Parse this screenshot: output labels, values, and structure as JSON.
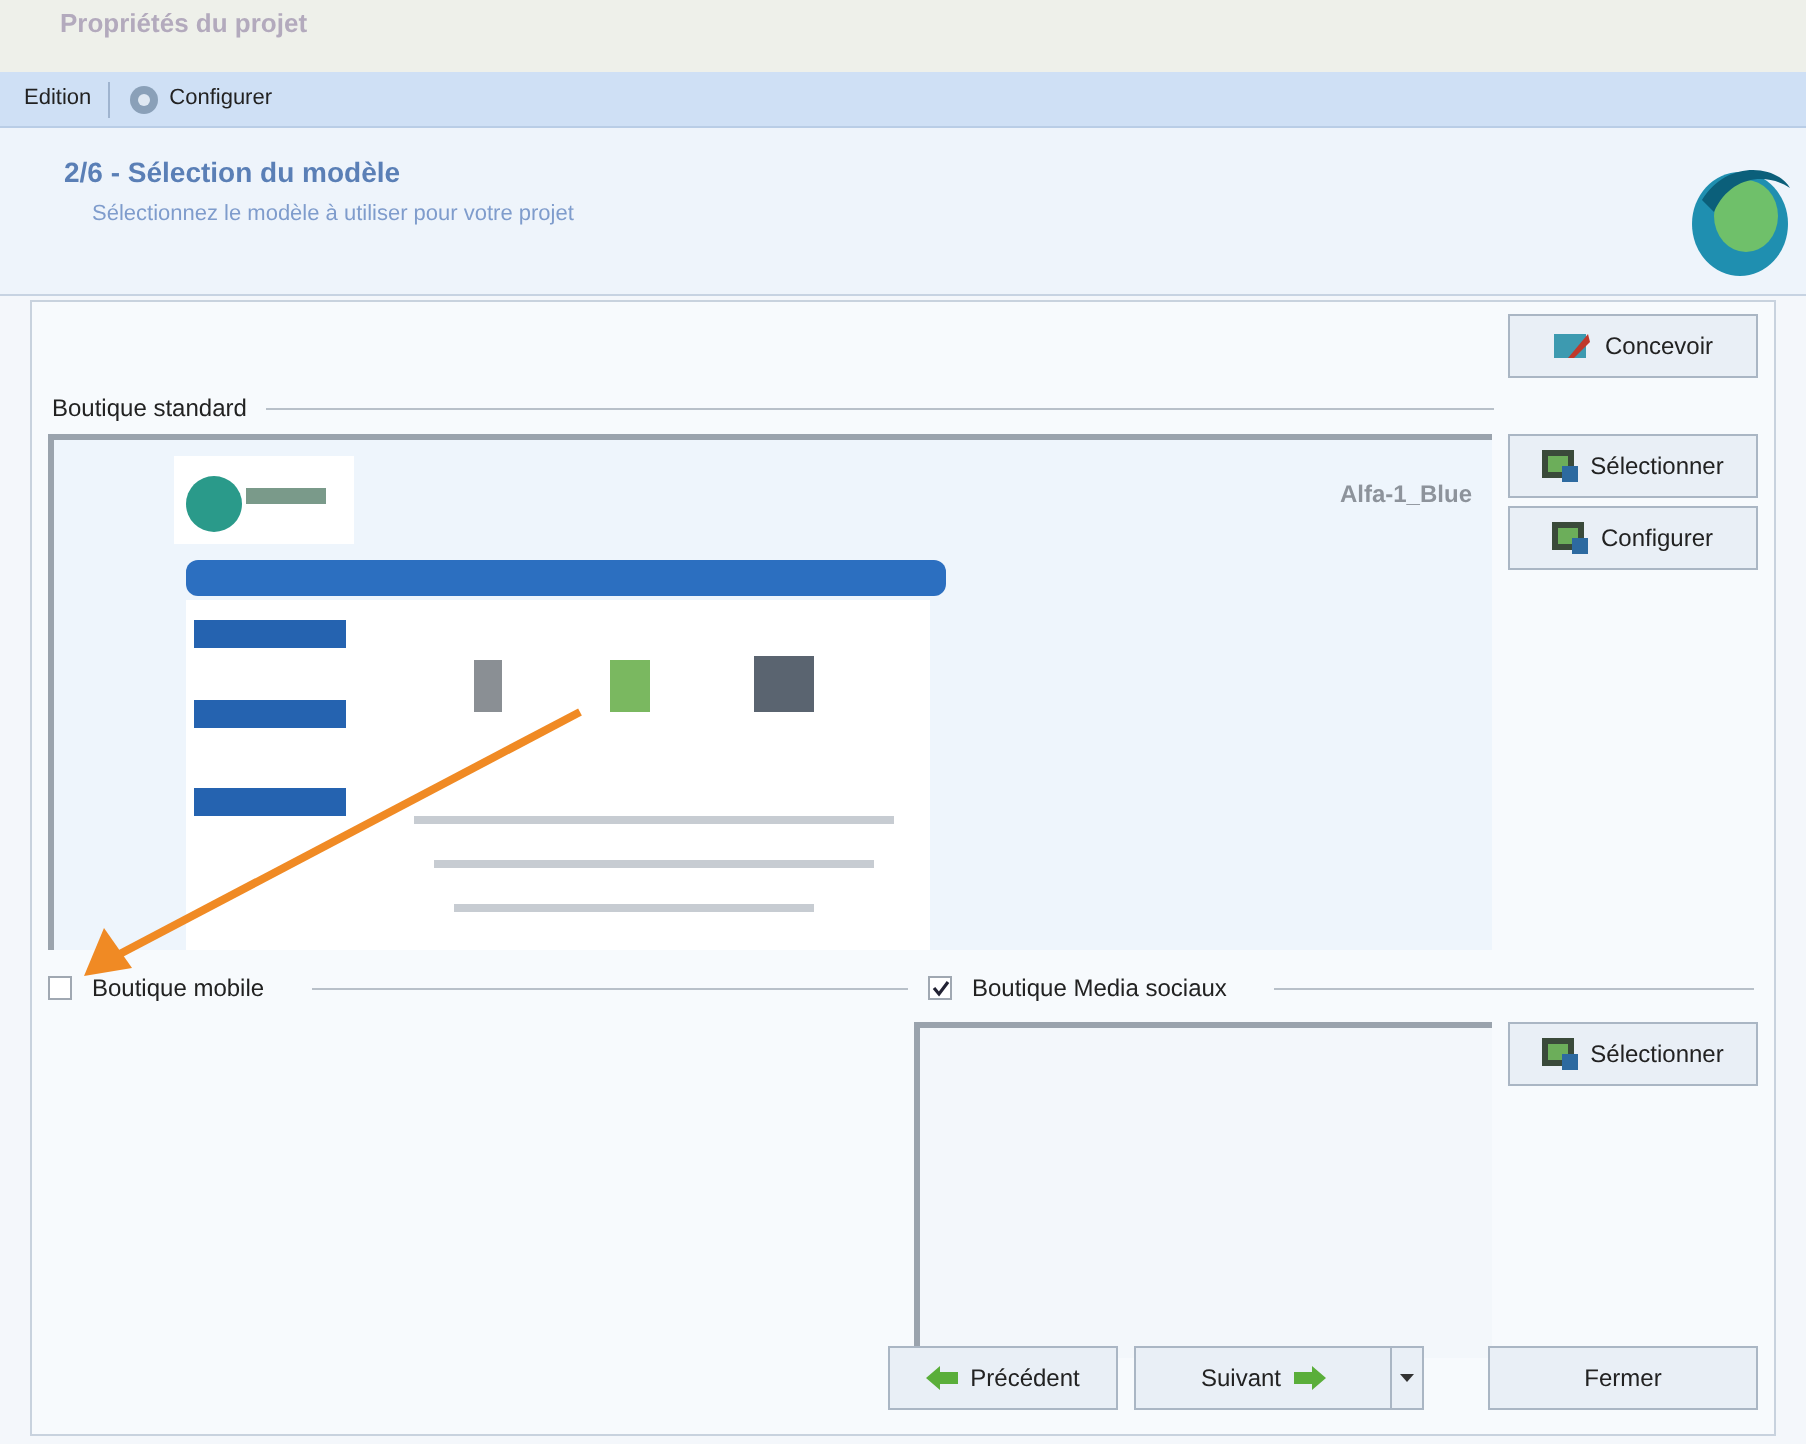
{
  "window": {
    "title": "Propriétés du projet"
  },
  "menu": [
    {
      "label": "Edition",
      "kind": "text"
    },
    {
      "label": "Configurer",
      "kind": "icon"
    }
  ],
  "header": {
    "step": "2/6 - Sélection du modèle",
    "subtitle": "Sélectionnez le modèle à utiliser pour votre projet"
  },
  "design_button": "Concevoir",
  "standard": {
    "label": "Boutique standard",
    "template_name": "Alfa-1_Blue",
    "buttons": [
      "Sélectionner",
      "Configurer"
    ]
  },
  "mobile": {
    "label": "Boutique mobile",
    "checked": false
  },
  "social": {
    "label": "Boutique Media sociaux",
    "checked": true,
    "buttons": [
      "Sélectionner"
    ]
  },
  "footer": [
    {
      "label": "Précédent",
      "kind": "back"
    },
    {
      "label": "Suivant",
      "kind": "next"
    },
    {
      "label": "Fermer",
      "kind": "plain"
    }
  ]
}
